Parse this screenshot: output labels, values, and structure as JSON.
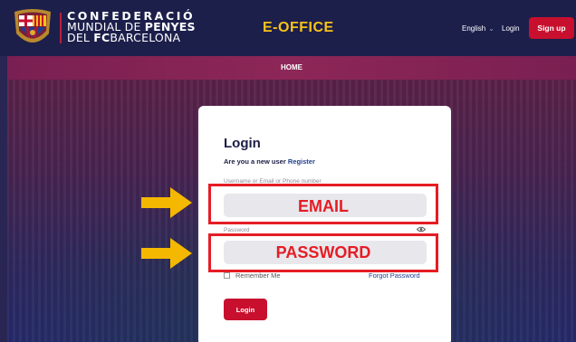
{
  "header": {
    "logo_line1": "CONFEDERACIÓ",
    "logo_line2_pre": "MUNDIAL DE ",
    "logo_line2_bold": "PENYES",
    "logo_line3_pre": "DEL ",
    "logo_line3_bold": "FC",
    "logo_line3_post": "BARCELONA",
    "title": "E-OFFICE",
    "language": "English",
    "login": "Login",
    "signup": "Sign up"
  },
  "nav": {
    "home": "HOME"
  },
  "login_card": {
    "title": "Login",
    "subtitle_prefix": "Are you a new user ",
    "register_link": "Register",
    "email_label": "Username or Email or Phone number",
    "password_label": "Password",
    "remember_me": "Remember Me",
    "forgot_password": "Forgot Password",
    "login_button": "Login"
  },
  "annotations": {
    "email_text": "EMAIL",
    "password_text": "PASSWORD",
    "arrow_icon": "right-arrow-icon",
    "arrow_color": "#f5b800",
    "box_color": "#e51d24"
  },
  "colors": {
    "brand_red": "#c8102e",
    "navy": "#1d1f4b",
    "gold": "#f5c319"
  }
}
